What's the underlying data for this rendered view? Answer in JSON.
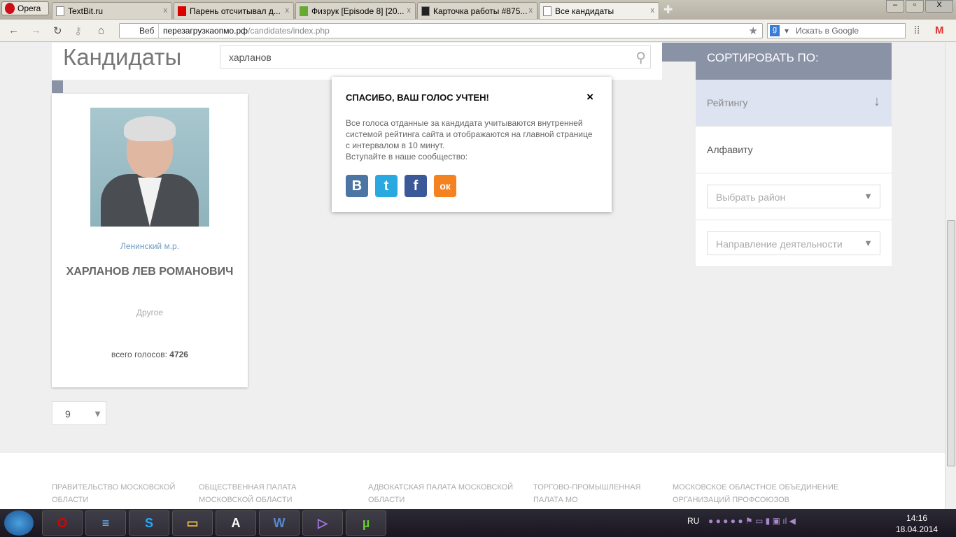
{
  "browser": {
    "opera_label": "Opera",
    "tabs": [
      {
        "label": "TextBit.ru",
        "active": false
      },
      {
        "label": "Парень отсчитывал д...",
        "active": false
      },
      {
        "label": "Физрук [Episode 8] [20...",
        "active": false
      },
      {
        "label": "Карточка работы #875...",
        "active": false
      },
      {
        "label": "Все кандидаты",
        "active": true
      }
    ],
    "web_label": "Веб",
    "url_host": "перезагрузкаопмо.рф",
    "url_path": "/candidates/index.php",
    "search_placeholder": "Искать в Google"
  },
  "page": {
    "title": "Кандидаты",
    "search_value": "харланов",
    "candidate": {
      "district": "Ленинский м.р.",
      "name": "ХАРЛАНОВ ЛЕВ РОМАНОВИЧ",
      "category": "Другое",
      "votes_label": "всего голосов:",
      "votes": "4726"
    },
    "pager_value": "9",
    "modal": {
      "title": "СПАСИБО, ВАШ ГОЛОС УЧТЕН!",
      "close": "×",
      "text": "Все голоса отданные за кандидата учитываются внутренней системой рейтинга сайта и отображаются на главной странице с интервалом в 10 минут.",
      "join": "Вступайте в наше сообщество:",
      "social": [
        {
          "name": "vk",
          "glyph": "В",
          "color": "#4c75a3"
        },
        {
          "name": "twitter",
          "glyph": "t",
          "color": "#2aa9e0"
        },
        {
          "name": "facebook",
          "glyph": "f",
          "color": "#3b5998"
        },
        {
          "name": "odnoklassniki",
          "glyph": "ок",
          "color": "#f58220"
        }
      ]
    },
    "sidebar": {
      "header": "СОРТИРОВАТЬ ПО:",
      "sort_rating": "Рейтингу",
      "sort_alpha": "Алфавиту",
      "district_select": "Выбрать район",
      "activity_select": "Направление деятельности"
    },
    "footer": [
      "ПРАВИТЕЛЬСТВО МОСКОВСКОЙ ОБЛАСТИ",
      "ОБЩЕСТВЕННАЯ ПАЛАТА МОСКОВСКОЙ ОБЛАСТИ",
      "АДВОКАТСКАЯ ПАЛАТА МОСКОВСКОЙ ОБЛАСТИ",
      "ТОРГОВО-ПРОМЫШЛЕННАЯ ПАЛАТА МО",
      "МОСКОВСКОЕ ОБЛАСТНОЕ ОБЪЕДИНЕНИЕ ОРГАНИЗАЦИЙ ПРОФСОЮЗОВ"
    ]
  },
  "taskbar": {
    "lang": "RU",
    "time": "14:16",
    "date": "18.04.2014"
  }
}
